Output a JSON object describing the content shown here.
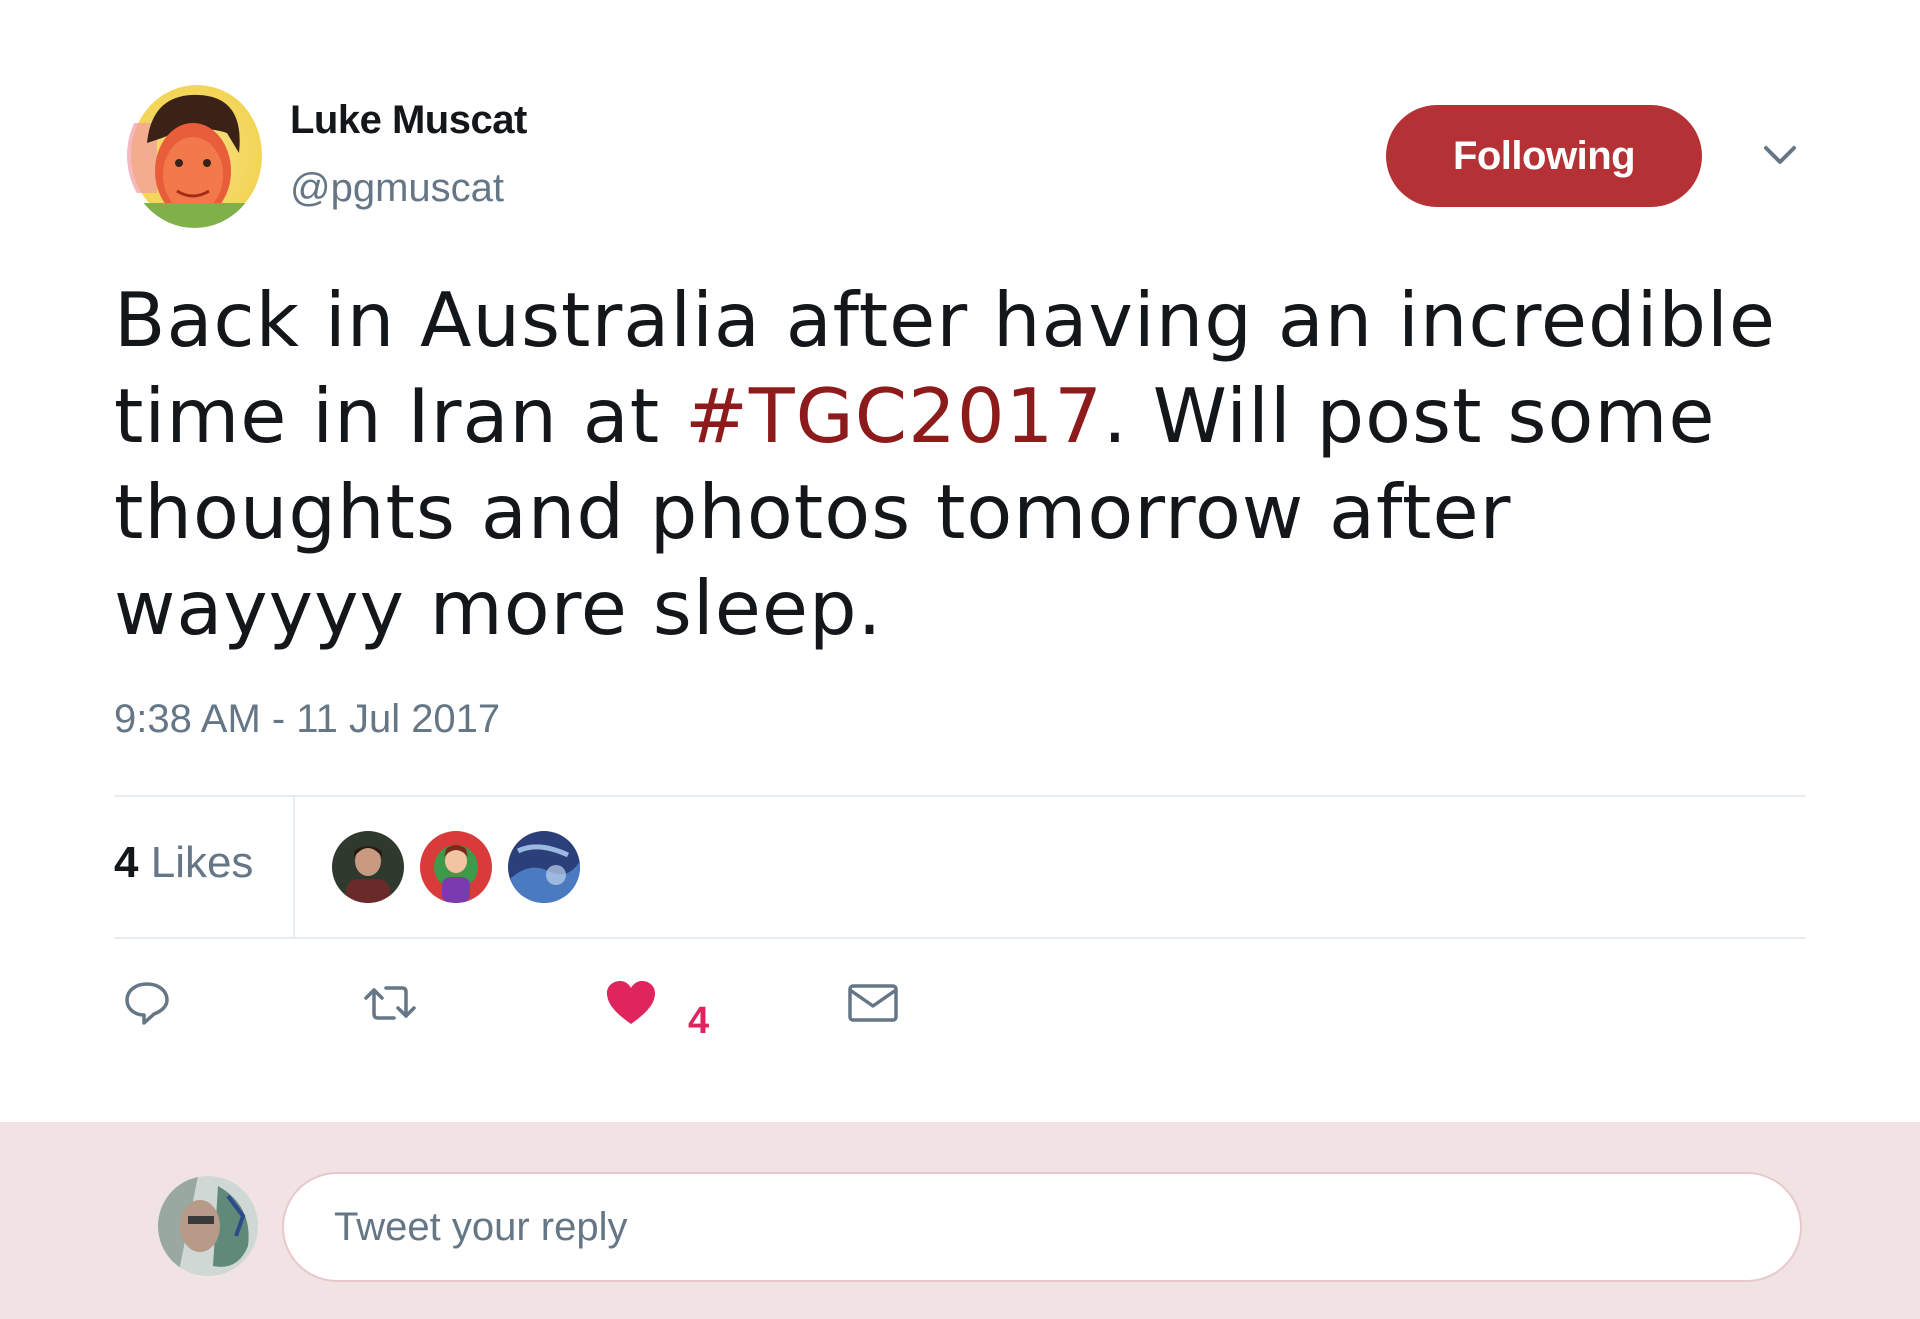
{
  "user": {
    "display_name": "Luke Muscat",
    "username": "@pgmuscat",
    "avatar_icon": "profile-photo"
  },
  "follow_button": {
    "label": "Following",
    "color": "#b43236"
  },
  "tweet": {
    "text_before": "Back in Australia after having an incredible time in Iran at ",
    "hashtag": "#TGC2017",
    "text_after": ". Will post some thoughts and photos tomorrow after wayyyy more sleep.",
    "timestamp": "9:38 AM - 11 Jul 2017",
    "hashtag_color": "#8e1b1b"
  },
  "stats": {
    "likes_count": "4",
    "likes_label": "Likes",
    "liker_avatars": [
      "liker-avatar-1",
      "liker-avatar-2",
      "liker-avatar-3"
    ]
  },
  "actions": {
    "reply_icon": "speech-bubble-icon",
    "retweet_icon": "retweet-icon",
    "like_icon": "heart-icon",
    "like_count": "4",
    "like_color": "#e0245e",
    "dm_icon": "envelope-icon"
  },
  "reply": {
    "placeholder": "Tweet your reply",
    "background": "#f1e2e3"
  }
}
